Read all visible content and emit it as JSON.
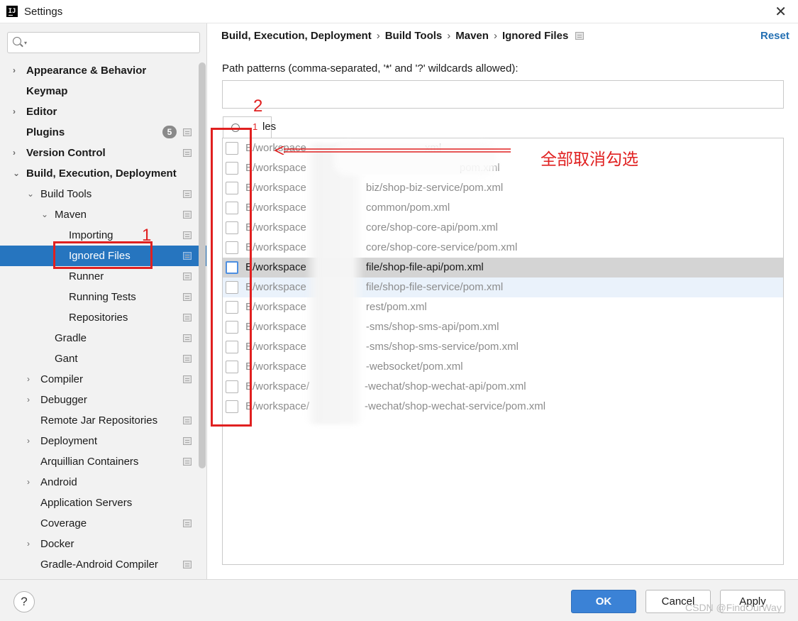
{
  "window": {
    "title": "Settings",
    "close_glyph": "✕"
  },
  "sidebar": {
    "search_placeholder": "",
    "items": [
      {
        "label": "Appearance & Behavior",
        "bold": true,
        "level": 0,
        "arrow": "›"
      },
      {
        "label": "Keymap",
        "bold": true,
        "level": 0,
        "arrow": ""
      },
      {
        "label": "Editor",
        "bold": true,
        "level": 0,
        "arrow": "›"
      },
      {
        "label": "Plugins",
        "bold": true,
        "level": 0,
        "arrow": "",
        "badge": "5",
        "page_icon": true
      },
      {
        "label": "Version Control",
        "bold": true,
        "level": 0,
        "arrow": "›",
        "page_icon": true
      },
      {
        "label": "Build, Execution, Deployment",
        "bold": true,
        "level": 0,
        "arrow": "⌄"
      },
      {
        "label": "Build Tools",
        "bold": false,
        "level": 1,
        "arrow": "⌄",
        "page_icon": true
      },
      {
        "label": "Maven",
        "bold": false,
        "level": 2,
        "arrow": "⌄",
        "page_icon": true
      },
      {
        "label": "Importing",
        "bold": false,
        "level": 3,
        "arrow": "",
        "page_icon": true
      },
      {
        "label": "Ignored Files",
        "bold": false,
        "level": 3,
        "arrow": "",
        "page_icon": true,
        "selected": true
      },
      {
        "label": "Runner",
        "bold": false,
        "level": 3,
        "arrow": "",
        "page_icon": true
      },
      {
        "label": "Running Tests",
        "bold": false,
        "level": 3,
        "arrow": "",
        "page_icon": true
      },
      {
        "label": "Repositories",
        "bold": false,
        "level": 3,
        "arrow": "",
        "page_icon": true
      },
      {
        "label": "Gradle",
        "bold": false,
        "level": 2,
        "arrow": "",
        "page_icon": true
      },
      {
        "label": "Gant",
        "bold": false,
        "level": 2,
        "arrow": "",
        "page_icon": true
      },
      {
        "label": "Compiler",
        "bold": false,
        "level": 1,
        "arrow": "›",
        "page_icon": true
      },
      {
        "label": "Debugger",
        "bold": false,
        "level": 1,
        "arrow": "›"
      },
      {
        "label": "Remote Jar Repositories",
        "bold": false,
        "level": 1,
        "arrow": "",
        "page_icon": true
      },
      {
        "label": "Deployment",
        "bold": false,
        "level": 1,
        "arrow": "›",
        "page_icon": true
      },
      {
        "label": "Arquillian Containers",
        "bold": false,
        "level": 1,
        "arrow": "",
        "page_icon": true
      },
      {
        "label": "Android",
        "bold": false,
        "level": 1,
        "arrow": "›"
      },
      {
        "label": "Application Servers",
        "bold": false,
        "level": 1,
        "arrow": ""
      },
      {
        "label": "Coverage",
        "bold": false,
        "level": 1,
        "arrow": "",
        "page_icon": true
      },
      {
        "label": "Docker",
        "bold": false,
        "level": 1,
        "arrow": "›"
      },
      {
        "label": "Gradle-Android Compiler",
        "bold": false,
        "level": 1,
        "arrow": "",
        "page_icon": true
      }
    ]
  },
  "breadcrumb": {
    "parts": [
      "Build, Execution, Deployment",
      "Build Tools",
      "Maven",
      "Ignored Files"
    ],
    "separator": "›"
  },
  "reset_label": "Reset",
  "path_patterns": {
    "label": "Path patterns (comma-separated, '*' and '?' wildcards allowed):",
    "value": ""
  },
  "files_search_text": "les",
  "files": [
    {
      "path": "E/workspace",
      "suffix": "xml",
      "checked": false
    },
    {
      "path": "E/workspace",
      "suffix": "pom.xml",
      "checked": false
    },
    {
      "path": "E/workspace",
      "suffix": "biz/shop-biz-service/pom.xml",
      "checked": false
    },
    {
      "path": "E/workspace",
      "suffix": "common/pom.xml",
      "checked": false
    },
    {
      "path": "E/workspace",
      "suffix": "core/shop-core-api/pom.xml",
      "checked": false
    },
    {
      "path": "E/workspace",
      "suffix": "core/shop-core-service/pom.xml",
      "checked": false
    },
    {
      "path": "E/workspace",
      "suffix": "file/shop-file-api/pom.xml",
      "checked": false,
      "focused": true
    },
    {
      "path": "E/workspace",
      "suffix": "file/shop-file-service/pom.xml",
      "checked": false,
      "hover": true
    },
    {
      "path": "E/workspace",
      "suffix": "rest/pom.xml",
      "checked": false
    },
    {
      "path": "E/workspace",
      "suffix": "-sms/shop-sms-api/pom.xml",
      "checked": false
    },
    {
      "path": "E/workspace",
      "suffix": "-sms/shop-sms-service/pom.xml",
      "checked": false
    },
    {
      "path": "E/workspace",
      "suffix": "-websocket/pom.xml",
      "checked": false
    },
    {
      "path": "E/workspace/",
      "suffix": "-wechat/shop-wechat-api/pom.xml",
      "checked": false
    },
    {
      "path": "E/workspace/",
      "suffix": "-wechat/shop-wechat-service/pom.xml",
      "checked": false
    }
  ],
  "annotations": {
    "num_1": "1",
    "num_2": "2",
    "num_small": "1",
    "note": "全部取消勾选",
    "color": "#e02020"
  },
  "footer": {
    "help_label": "?",
    "ok_label": "OK",
    "cancel_label": "Cancel",
    "apply_label": "Apply",
    "watermark": "CSDN @FindOurWay"
  }
}
